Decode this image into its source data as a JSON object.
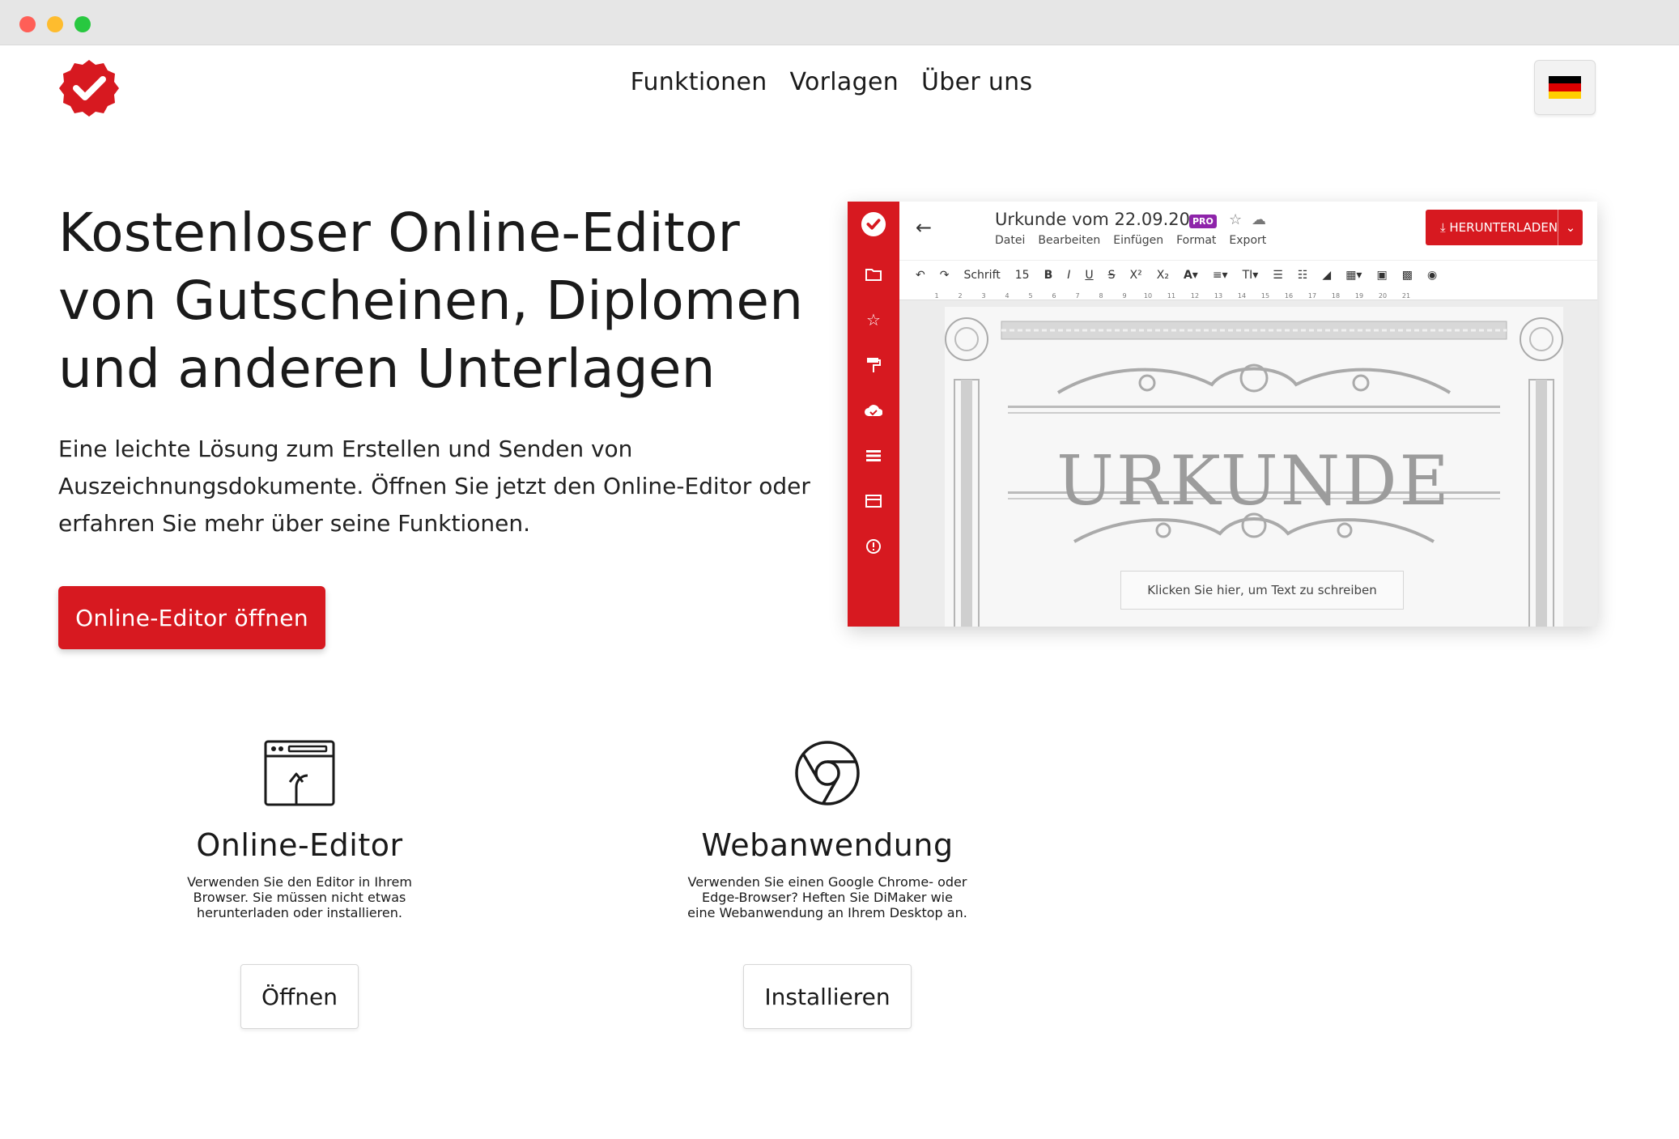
{
  "nav": {
    "items": [
      "Funktionen",
      "Vorlagen",
      "Über uns"
    ]
  },
  "language": {
    "icon": "german-flag-icon",
    "colors": [
      "#000000",
      "#dd0000",
      "#ffce00"
    ]
  },
  "brand": {
    "color": "#d71920",
    "logo_icon": "checkmark-badge-icon"
  },
  "hero": {
    "title_lines": [
      "Kostenloser Online-Editor",
      "von Gutscheinen, Diplomen",
      "und anderen Unterlagen"
    ],
    "description_lines": [
      "Eine leichte Lösung zum Erstellen und Senden von",
      "Auszeichnungsdokumente. Öffnen Sie jetzt den Online-Editor oder",
      "erfahren Sie mehr über seine Funktionen."
    ],
    "cta_label": "Online-Editor öffnen"
  },
  "preview": {
    "doc_title": "Urkunde vom 22.09.20",
    "pro_badge": "PRO",
    "menu": [
      "Datei",
      "Bearbeiten",
      "Einfügen",
      "Format",
      "Export"
    ],
    "download_label": "HERUNTERLADEN",
    "toolbar": {
      "font_label": "Schrift",
      "font_size": "15",
      "buttons": [
        "undo",
        "redo",
        "bold",
        "italic",
        "underline",
        "strikethrough",
        "superscript",
        "subscript",
        "text-color",
        "align",
        "text-size",
        "bullet-list",
        "numbered-list",
        "eraser",
        "table",
        "image",
        "qr-code",
        "record"
      ]
    },
    "ruler_marks": [
      "1",
      "2",
      "3",
      "4",
      "5",
      "6",
      "7",
      "8",
      "9",
      "10",
      "11",
      "12",
      "13",
      "14",
      "15",
      "16",
      "17",
      "18",
      "19",
      "20",
      "21"
    ],
    "sidebar_icons": [
      "logo-icon",
      "folder-icon",
      "star-icon",
      "paint-roller-icon",
      "cloud-icon",
      "list-icon",
      "layout-icon",
      "info-icon"
    ],
    "certificate_word": "URKUNDE",
    "certificate_placeholder": "Klicken Sie hier, um Text zu schreiben"
  },
  "features": [
    {
      "icon": "browser-upload-icon",
      "title": "Online-Editor",
      "desc_lines": [
        "Verwenden Sie den Editor in Ihrem",
        "Browser. Sie müssen nicht etwas",
        "herunterladen oder installieren."
      ],
      "button_label": "Öffnen"
    },
    {
      "icon": "chrome-icon",
      "title": "Webanwendung",
      "desc_lines": [
        "Verwenden Sie einen Google Chrome- oder",
        "Edge-Browser? Heften Sie DiMaker wie",
        "eine Webanwendung an Ihrem Desktop an."
      ],
      "button_label": "Installieren"
    }
  ]
}
